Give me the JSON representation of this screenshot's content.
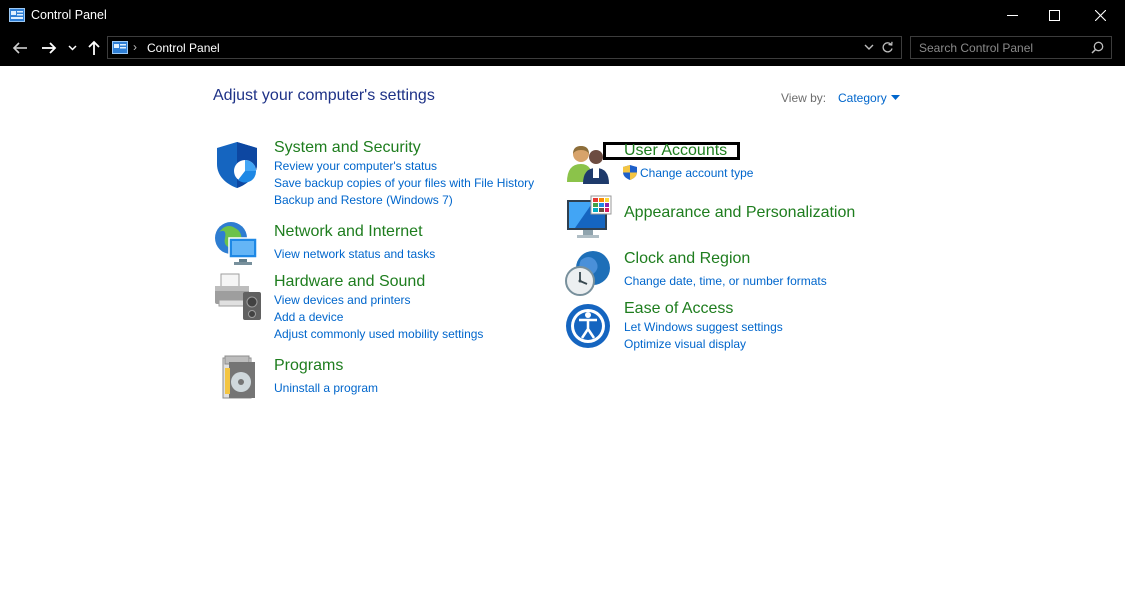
{
  "window": {
    "title": "Control Panel"
  },
  "addressbar": {
    "crumb": "Control Panel",
    "search_placeholder": "Search Control Panel"
  },
  "content": {
    "title": "Adjust your computer's settings",
    "view_by_label": "View by:",
    "view_by_value": "Category"
  },
  "categories": {
    "system": {
      "title": "System and Security",
      "links": [
        "Review your computer's status",
        "Save backup copies of your files with File History",
        "Backup and Restore (Windows 7)"
      ]
    },
    "network": {
      "title": "Network and Internet",
      "links": [
        "View network status and tasks"
      ]
    },
    "hardware": {
      "title": "Hardware and Sound",
      "links": [
        "View devices and printers",
        "Add a device",
        "Adjust commonly used mobility settings"
      ]
    },
    "programs": {
      "title": "Programs",
      "links": [
        "Uninstall a program"
      ]
    },
    "user": {
      "title": "User Accounts",
      "links": [
        "Change account type"
      ]
    },
    "appearance": {
      "title": "Appearance and Personalization",
      "links": []
    },
    "clock": {
      "title": "Clock and Region",
      "links": [
        "Change date, time, or number formats"
      ]
    },
    "ease": {
      "title": "Ease of Access",
      "links": [
        "Let Windows suggest settings",
        "Optimize visual display"
      ]
    }
  },
  "colors": {
    "link": "#0066cc",
    "heading_green": "#1e7d1e",
    "title_blue": "#1e3287",
    "chrome": "#000000"
  }
}
